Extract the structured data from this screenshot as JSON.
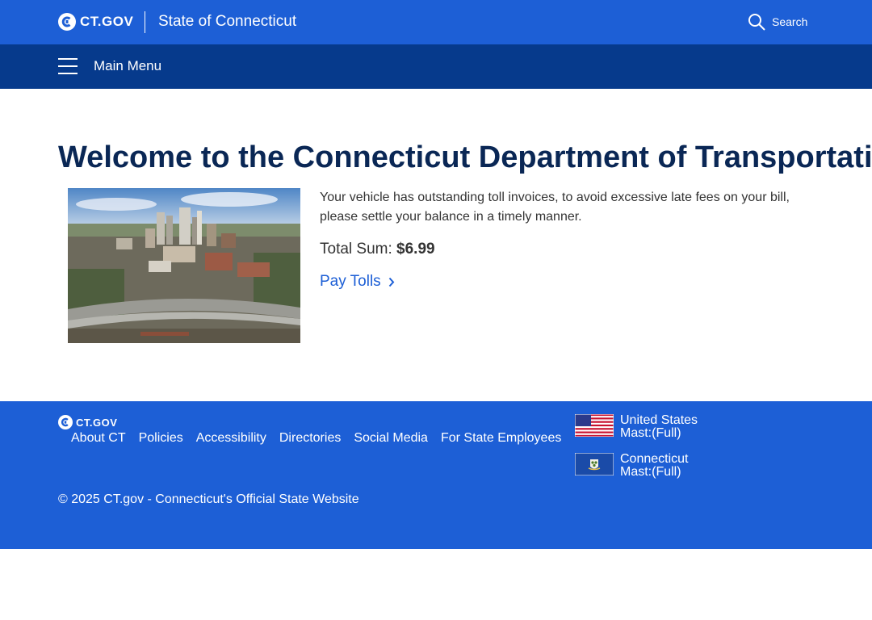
{
  "header": {
    "logo_text": "CT.GOV",
    "state_title": "State of Connecticut",
    "search_label": "Search"
  },
  "menu": {
    "label": "Main Menu"
  },
  "main": {
    "title": "Welcome to the Connecticut Department of Transportation",
    "notice": "Your vehicle has outstanding toll invoices, to avoid excessive late fees on your bill, please settle your balance in a timely manner.",
    "total_label": "Total Sum: ",
    "total_amount": "$6.99",
    "pay_link": "Pay Tolls"
  },
  "footer": {
    "logo_text": "CT.GOV",
    "links": [
      "About CT",
      "Policies",
      "Accessibility",
      "Directories",
      "Social Media",
      "For State Employees"
    ],
    "flags": [
      {
        "line1": "United States",
        "line2": "Mast:(Full)"
      },
      {
        "line1": "Connecticut",
        "line2": "Mast:(Full)"
      }
    ],
    "copyright": "© 2025 CT.gov - Connecticut's Official State Website"
  },
  "colors": {
    "primary_blue": "#1d5fd6",
    "dark_blue": "#063a8c",
    "title_navy": "#0a2755"
  }
}
